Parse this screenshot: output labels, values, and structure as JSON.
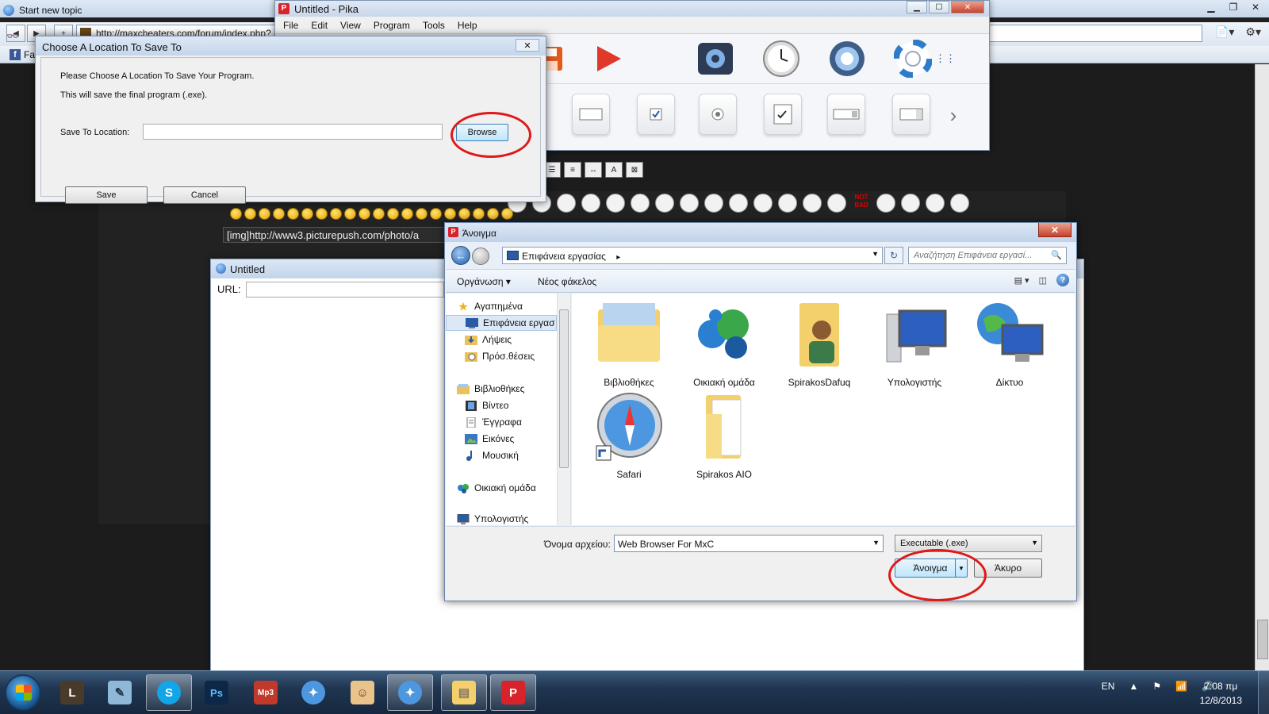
{
  "browser": {
    "tab_title": "Start new topic",
    "url": "http://maxcheaters.com/forum/index.php?",
    "favorites_label": "Fa",
    "facebook_glyph": "f",
    "win_min": "▁",
    "win_restore": "❐",
    "win_close": "✕",
    "back": "◀",
    "forward": "▶",
    "new_tab": "+",
    "tools": [
      "📄▾",
      "⚙▾"
    ]
  },
  "forum": {
    "img_text": "[img]http://www3.picturepush.com/photo/a",
    "notbad": "NOT BAD"
  },
  "untitled_window": {
    "title": "Untitled",
    "url_label": "URL:"
  },
  "pika": {
    "title": "Untitled - Pika",
    "logo": "P",
    "menu": [
      "File",
      "Edit",
      "View",
      "Program",
      "Tools",
      "Help"
    ],
    "ctrl_min": "▁",
    "ctrl_max": "☐",
    "ctrl_close": "✕",
    "more": "⋮⋮",
    "next_arrow": "›"
  },
  "choose_dialog": {
    "title": "Choose A Location To Save To",
    "close": "✕",
    "line1": "Please Choose A Location To Save Your Program.",
    "line2": "This will save the final program (.exe).",
    "location_label": "Save To Location:",
    "location_value": "",
    "browse_label": "Browse",
    "save_label": "Save",
    "cancel_label": "Cancel"
  },
  "open_dialog": {
    "title": "Άνοιγμα",
    "logo": "P",
    "close": "✕",
    "back": "←",
    "path": "Επιφάνεια εργασίας",
    "path_arrow": "▸",
    "refresh": "↻",
    "search_placeholder": "Αναζήτηση Επιφάνεια εργασί...",
    "search_glyph": "🔍",
    "organize_label": "Οργάνωση ▾",
    "new_folder_label": "Νέος φάκελος",
    "view_glyph": "▤ ▾",
    "pane_glyph": "◫",
    "help_glyph": "?",
    "nav_items": [
      {
        "label": "Αγαπημένα",
        "icon": "star-icon"
      },
      {
        "label": "Επιφάνεια εργασ",
        "icon": "desktop-icon"
      },
      {
        "label": "Λήψεις",
        "icon": "downloads-icon"
      },
      {
        "label": "Πρόσ.θέσεις",
        "icon": "recent-places-icon"
      },
      {
        "label": "Βιβλιοθήκες",
        "icon": "libraries-icon"
      },
      {
        "label": "Βίντεο",
        "icon": "video-icon"
      },
      {
        "label": "Έγγραφα",
        "icon": "documents-icon"
      },
      {
        "label": "Εικόνες",
        "icon": "pictures-icon"
      },
      {
        "label": "Μουσική",
        "icon": "music-icon"
      },
      {
        "label": "Οικιακή ομάδα",
        "icon": "homegroup-icon"
      },
      {
        "label": "Υπολογιστής",
        "icon": "computer-icon"
      }
    ],
    "files": [
      {
        "label": "Βιβλιοθήκες",
        "icon": "libraries-folder-icon"
      },
      {
        "label": "Οικιακή ομάδα",
        "icon": "homegroup-icon"
      },
      {
        "label": "SpirakosDafuq",
        "icon": "user-folder-icon"
      },
      {
        "label": "Υπολογιστής",
        "icon": "computer-icon"
      },
      {
        "label": "Δίκτυο",
        "icon": "network-icon"
      },
      {
        "label": "Safari",
        "icon": "safari-shortcut-icon"
      },
      {
        "label": "Spirakos AIO",
        "icon": "folder-icon"
      }
    ],
    "filename_label": "Όνομα αρχείου:",
    "filename_value": "Web Browser For MxC",
    "filetype_value": "Executable (.exe)",
    "open_label": "Άνοιγμα",
    "cancel_label": "Άκυρο",
    "dropdown_glyph": "▼"
  },
  "taskbar": {
    "apps": [
      {
        "name": "lineage-icon",
        "glyph": "L"
      },
      {
        "name": "notes-icon",
        "glyph": "✎"
      },
      {
        "name": "skype-icon",
        "glyph": "S"
      },
      {
        "name": "photoshop-icon",
        "glyph": "Ps"
      },
      {
        "name": "mp3-icon",
        "glyph": "Mp3"
      },
      {
        "name": "safari-icon",
        "glyph": "✦"
      },
      {
        "name": "anime-icon",
        "glyph": "☺"
      },
      {
        "name": "safari-icon-2",
        "glyph": "✦"
      },
      {
        "name": "explorer-icon",
        "glyph": "▤"
      },
      {
        "name": "pika-icon",
        "glyph": "P"
      }
    ],
    "lang": "EN",
    "tray_glyphs": [
      "▲",
      "⚑",
      "📶",
      "🔊"
    ],
    "time": "7:08 πμ",
    "date": "12/8/2013"
  }
}
